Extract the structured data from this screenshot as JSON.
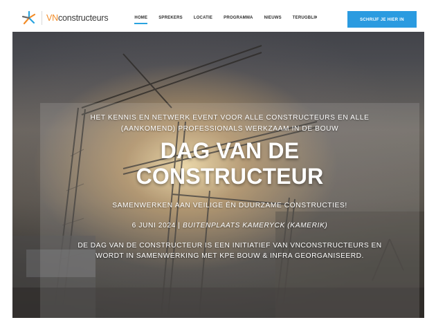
{
  "header": {
    "logo_prefix": "VN",
    "logo_suffix": "constructeurs",
    "nav": [
      {
        "label": "HOME",
        "active": true
      },
      {
        "label": "SPREKERS",
        "active": false
      },
      {
        "label": "LOCATIE",
        "active": false
      },
      {
        "label": "PROGRAMMA",
        "active": false
      },
      {
        "label": "NIEUWS",
        "active": false
      },
      {
        "label": "TERUGBLIK",
        "active": false
      }
    ],
    "cta_label": "SCHRIJF JE HIER IN"
  },
  "hero": {
    "intro_line1": "HET KENNIS EN NETWERK EVENT VOOR ALLE CONSTRUCTEURS EN ALLE",
    "intro_line2": "(AANKOMEND) PROFESSIONALS WERKZAAM IN DE BOUW",
    "title_line1": "DAG VAN DE",
    "title_line2": "CONSTRUCTEUR",
    "subtitle": "SAMENWERKEN AAN VEILIGE ÉN DUURZAME CONSTRUCTIES!",
    "date": "6 JUNI 2024",
    "date_separator": " | ",
    "location": "BUITENPLAATS KAMERYCK (KAMERIK)",
    "description_line1": "DE DAG VAN DE CONSTRUCTEUR IS EEN INITIATIEF VAN VNCONSTRUCTEURS EN",
    "description_line2": "WORDT IN SAMENWERKING MET KPE BOUW & INFRA GEORGANISEERD."
  },
  "colors": {
    "accent_blue": "#2b9be0",
    "logo_orange": "#f28c28",
    "logo_blue": "#29a3df"
  },
  "icons": {
    "logo_mark": "vn-star-logo-icon"
  }
}
